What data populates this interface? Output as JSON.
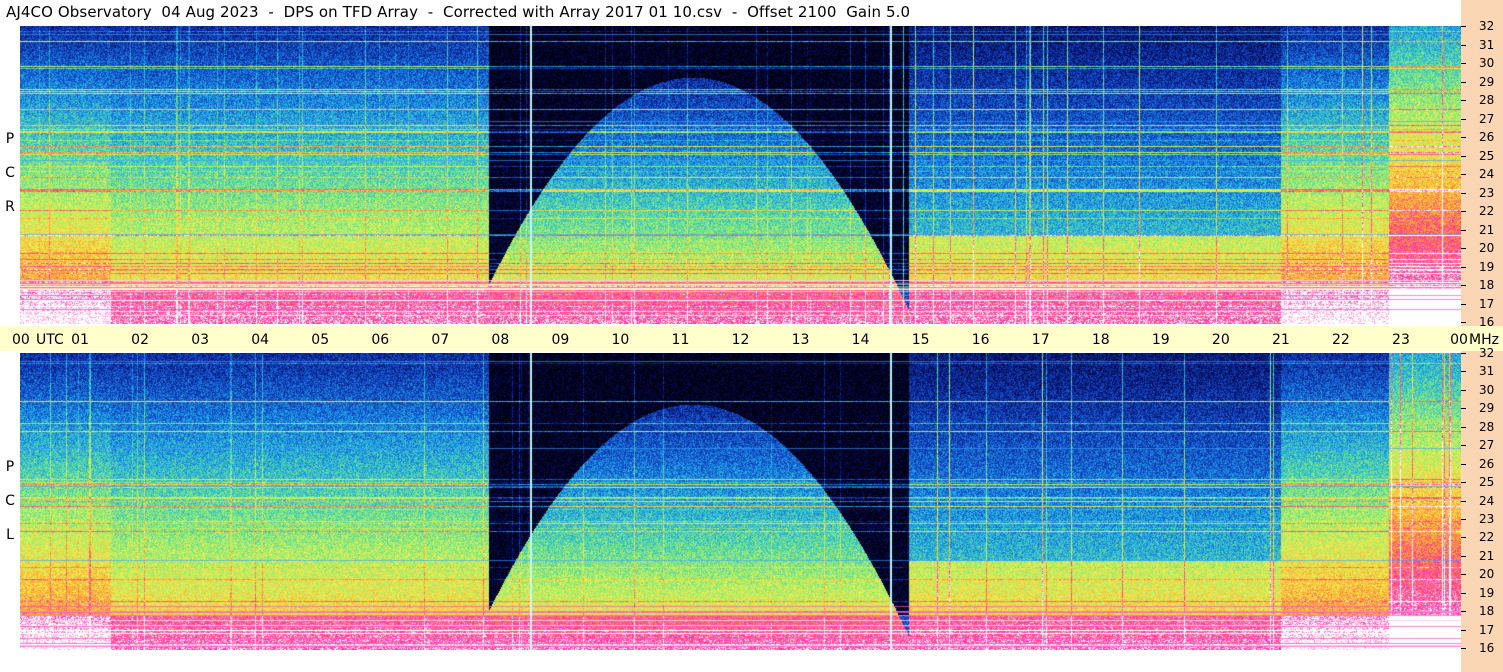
{
  "title": "AJ4CO Observatory  04 Aug 2023  -  DPS on TFD Array  -  Corrected with Array 2017 01 10.csv  -  Offset 2100  Gain 5.0",
  "panels": [
    {
      "label_letters": [
        "R",
        "C",
        "P"
      ]
    },
    {
      "label_letters": [
        "L",
        "C",
        "P"
      ]
    }
  ],
  "time_axis": {
    "unit_label": "UTC",
    "ticks": [
      "00",
      "01",
      "02",
      "03",
      "04",
      "05",
      "06",
      "07",
      "08",
      "09",
      "10",
      "11",
      "12",
      "13",
      "14",
      "15",
      "16",
      "17",
      "18",
      "19",
      "20",
      "21",
      "22",
      "23",
      "00"
    ]
  },
  "freq_axis": {
    "unit_label": "MHz",
    "ticks": [
      "32",
      "31",
      "30",
      "29",
      "28",
      "27",
      "26",
      "25",
      "24",
      "23",
      "22",
      "21",
      "20",
      "19",
      "18",
      "17",
      "16"
    ]
  },
  "chart_data": {
    "type": "heatmap",
    "title": "AJ4CO Observatory  04 Aug 2023  -  DPS on TFD Array  -  Corrected with Array 2017 01 10.csv  -  Offset 2100  Gain 5.0",
    "x_axis": {
      "label": "UTC",
      "range": [
        0,
        24
      ],
      "unit": "hours"
    },
    "y_axis": {
      "label": "MHz",
      "range": [
        16,
        32
      ]
    },
    "series": [
      {
        "name": "RCP",
        "time_markers_hours": [
          8.5,
          14.5
        ]
      },
      {
        "name": "LCP",
        "time_markers_hours": [
          8.5,
          14.5
        ]
      }
    ],
    "colormap": [
      "#000010",
      "#0a1a8a",
      "#1e6ee0",
      "#20c8e0",
      "#8af07a",
      "#f0f050",
      "#ffa030",
      "#ff2aa0",
      "#ffffff"
    ]
  }
}
